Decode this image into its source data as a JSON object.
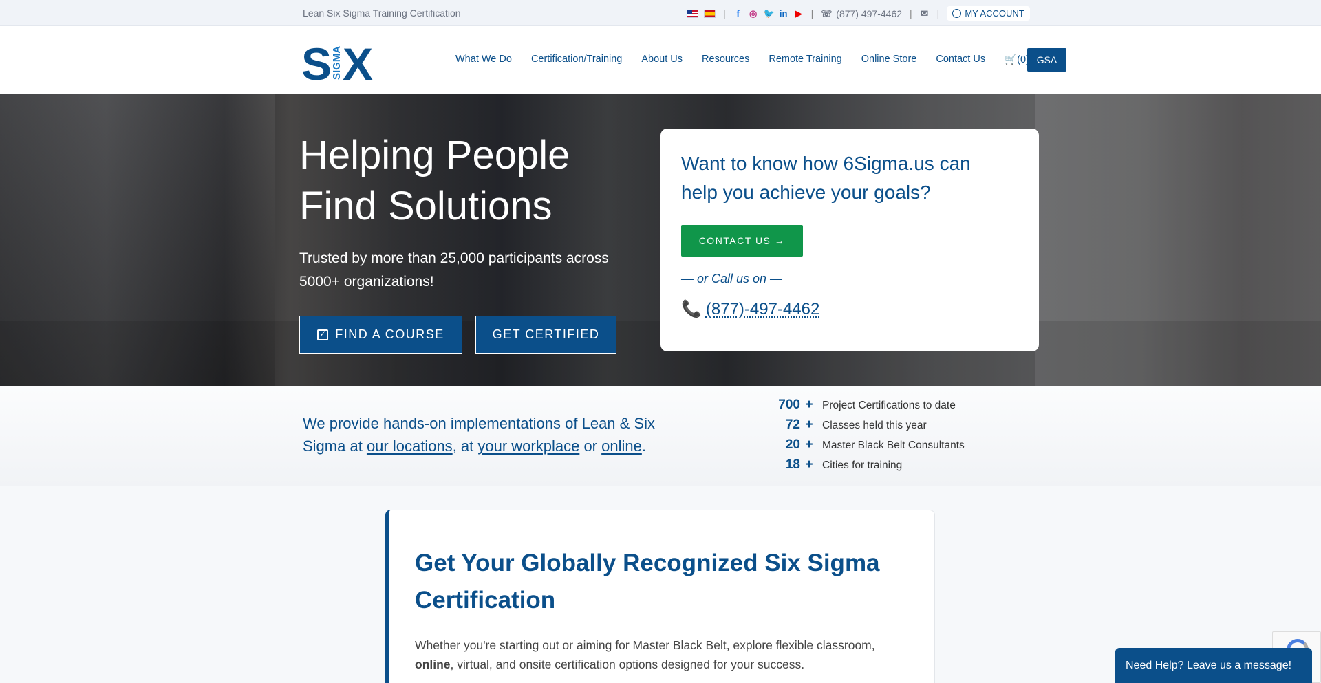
{
  "topbar": {
    "tagline": "Lean Six Sigma Training Certification",
    "phone": "(877) 497-4462",
    "separator": "|",
    "account": "MY ACCOUNT"
  },
  "header": {
    "logo_text_big": "SX",
    "logo_text_small": "SIGMA",
    "nav": [
      "What We Do",
      "Certification/Training",
      "About Us",
      "Resources",
      "Remote Training",
      "Online Store",
      "Contact Us"
    ],
    "cart": "(0)",
    "gsa": "GSA"
  },
  "hero": {
    "title": "Helping People Find Solutions",
    "subtitle": "Trusted by more than 25,000 participants across 5000+ organizations!",
    "find_course": "FIND A COURSE",
    "get_certified": "GET CERTIFIED",
    "card": {
      "heading": "Want to know how 6Sigma.us can help you achieve your goals?",
      "contact_button": "CONTACT US →",
      "or_call": "— or Call us on —",
      "phone": "(877)-497-4462"
    }
  },
  "band": {
    "lead_1": "We provide hands-on implementations of Lean & Six Sigma at ",
    "link_locations": "our locations",
    "lead_2": ", at ",
    "link_workplace": "your workplace",
    "lead_3": " or ",
    "link_online": "online",
    "lead_4": ".",
    "stats": [
      {
        "number": "700",
        "plus": "+",
        "label": "Project Certifications to date"
      },
      {
        "number": "72",
        "plus": "+",
        "label": "Classes held this year"
      },
      {
        "number": "20",
        "plus": "+",
        "label": "Master Black Belt Consultants"
      },
      {
        "number": "18",
        "plus": "+",
        "label": "Cities for training"
      }
    ]
  },
  "cert": {
    "heading": "Get Your Globally Recognized Six Sigma Certification",
    "para_1": "Whether you're starting out or aiming for Master Black Belt, explore flexible classroom, ",
    "para_bold": "online",
    "para_2": ", virtual, and onsite certification options designed for your success."
  },
  "chat": {
    "label": "Need Help? Leave us a message!"
  },
  "colors": {
    "brand": "#0b4f8a",
    "green": "#10964a"
  },
  "icons": [
    "flag-us-icon",
    "flag-es-icon",
    "facebook-icon",
    "instagram-icon",
    "twitter-icon",
    "linkedin-icon",
    "youtube-icon",
    "phone-icon",
    "mail-icon",
    "user-circle-icon",
    "cart-icon",
    "calendar-check-icon",
    "recaptcha-icon"
  ]
}
